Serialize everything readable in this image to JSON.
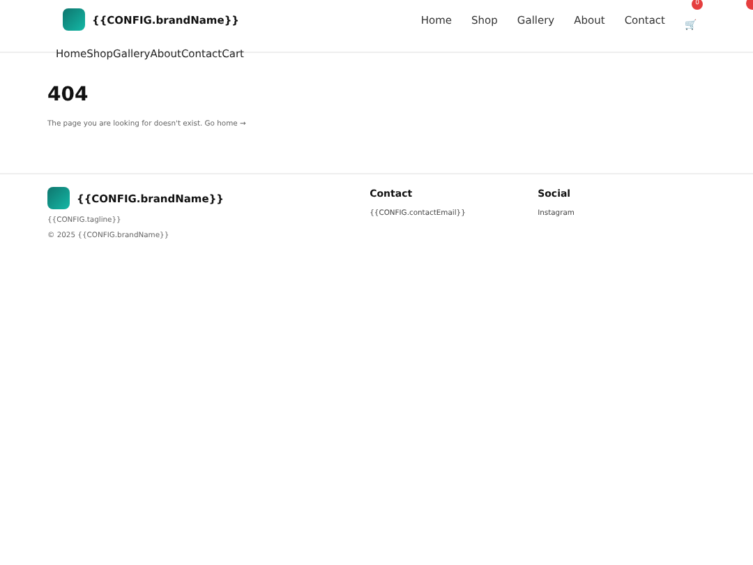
{
  "header": {
    "brand": "{{CONFIG.brandName}}",
    "nav": [
      "Home",
      "Shop",
      "Gallery",
      "About",
      "Contact"
    ],
    "cart_icon": "🛒",
    "cart_count": "0"
  },
  "plain_links": [
    "Home",
    "Shop",
    "Gallery",
    "About",
    "Contact",
    "Cart"
  ],
  "main": {
    "title": "404",
    "message": "The page you are looking for doesn't exist.",
    "link": "Go home →"
  },
  "footer": {
    "brand": "{{CONFIG.brandName}}",
    "tagline": "{{CONFIG.tagline}}",
    "copyright": "© 2025 {{CONFIG.brandName}}",
    "columns": [
      {
        "heading": "Contact",
        "items": [
          "{{CONFIG.contactEmail}}"
        ]
      },
      {
        "heading": "Social",
        "items": [
          "Instagram"
        ]
      }
    ]
  }
}
